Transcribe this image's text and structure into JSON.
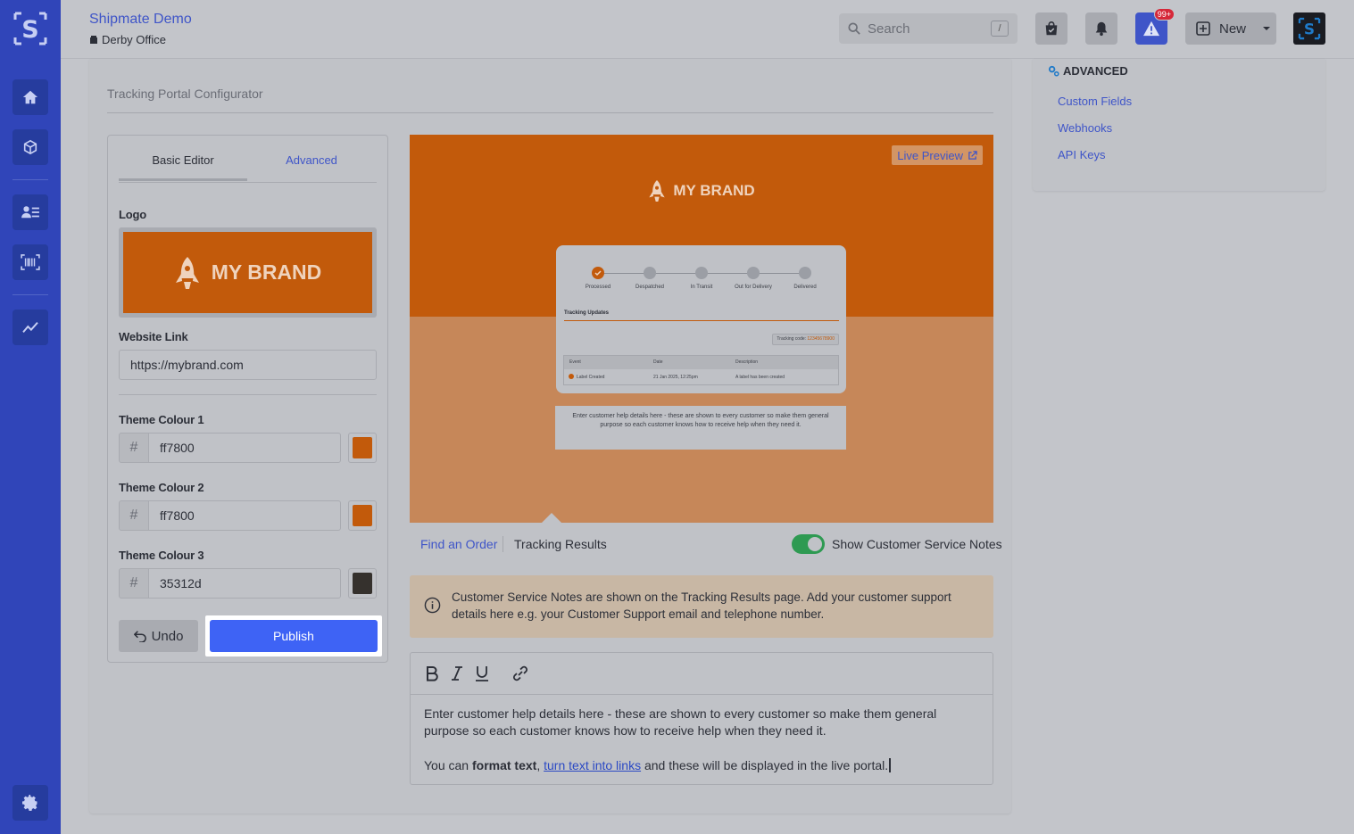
{
  "app": {
    "title": "Shipmate Demo",
    "office": "Derby Office"
  },
  "header": {
    "search_placeholder": "Search",
    "search_shortcut": "/",
    "alert_badge": "99+",
    "new_label": "New"
  },
  "sidebar": {
    "items": [
      "home",
      "packages",
      "contacts",
      "barcode-scanning",
      "analytics",
      "settings"
    ]
  },
  "configurator": {
    "title": "Tracking Portal Configurator",
    "tabs": {
      "basic": "Basic Editor",
      "advanced": "Advanced"
    },
    "logo_label": "Logo",
    "logo_text": "MY BRAND",
    "website_label": "Website Link",
    "website_value": "https://mybrand.com",
    "colour1_label": "Theme Colour 1",
    "colour1_value": "ff7800",
    "colour2_label": "Theme Colour 2",
    "colour2_value": "ff7800",
    "colour3_label": "Theme Colour 3",
    "colour3_value": "35312d",
    "hash": "#",
    "undo_label": "Undo",
    "publish_label": "Publish"
  },
  "preview": {
    "live_preview": "Live Preview",
    "brand": "MY BRAND",
    "steps": [
      "Processed",
      "Despatched",
      "In Transit",
      "Out for Delivery",
      "Delivered"
    ],
    "updates_title": "Tracking Updates",
    "tracking_code_label": "Tracking code:",
    "tracking_code": "12345678900",
    "table_headers": [
      "Event",
      "Date",
      "Description"
    ],
    "table_row": [
      "Label Created",
      "21 Jan 2025, 12:25pm",
      "A label has been created"
    ],
    "notes": "Enter customer help details here - these are shown to every customer so make them general purpose so each customer knows how to receive help when they need it."
  },
  "page_links": {
    "find_order": "Find an Order",
    "tracking_results": "Tracking Results",
    "show_notes": "Show Customer Service Notes"
  },
  "info_text": "Customer Service Notes are shown on the Tracking Results page. Add your customer support details here e.g. your Customer Support email and telephone number.",
  "editor": {
    "line1": "Enter customer help details here - these are shown to every customer so make them general purpose so each customer knows how to receive help when they need it.",
    "line2_start": "You can ",
    "line2_bold": "format text",
    "line2_comma": ", ",
    "line2_link": "turn text into links",
    "line2_end": " and these will be displayed in the live portal."
  },
  "advanced_panel": {
    "heading": "ADVANCED",
    "links": [
      "Custom Fields",
      "Webhooks",
      "API Keys"
    ]
  },
  "colors": {
    "brand_orange": "#c25a0b",
    "accent_blue": "#3e63f5",
    "sidebar_blue": "#3045b9",
    "swatch_dark": "#35312d",
    "toggle_green": "#2e9a52"
  }
}
